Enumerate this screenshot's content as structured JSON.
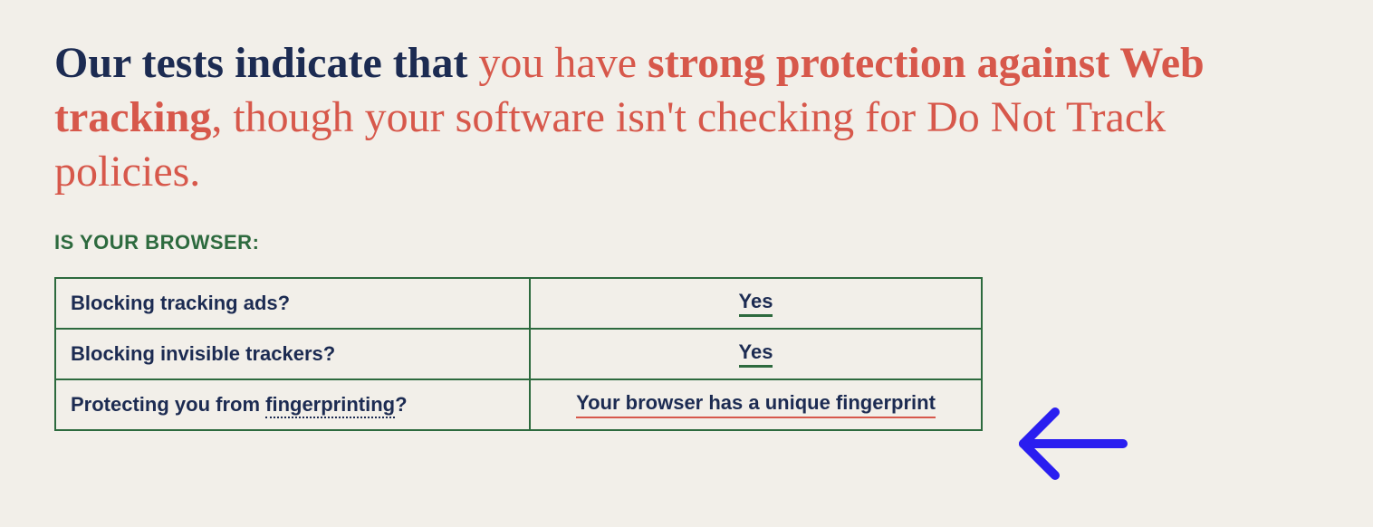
{
  "headline": {
    "part1": "Our tests indicate that ",
    "part2": "you have ",
    "part3": "strong protection against Web tracking",
    "part4": ", though your software isn't checking for Do Not Track policies."
  },
  "subhead": "IS YOUR BROWSER:",
  "rows": [
    {
      "label_pre": "Blocking tracking ads?",
      "label_link": "",
      "label_post": "",
      "value": "Yes",
      "value_style": "yes"
    },
    {
      "label_pre": "Blocking invisible trackers?",
      "label_link": "",
      "label_post": "",
      "value": "Yes",
      "value_style": "yes"
    },
    {
      "label_pre": "Protecting you from ",
      "label_link": "fingerprinting",
      "label_post": "?",
      "value": "Your browser has a unique fingerprint",
      "value_style": "unique"
    }
  ]
}
